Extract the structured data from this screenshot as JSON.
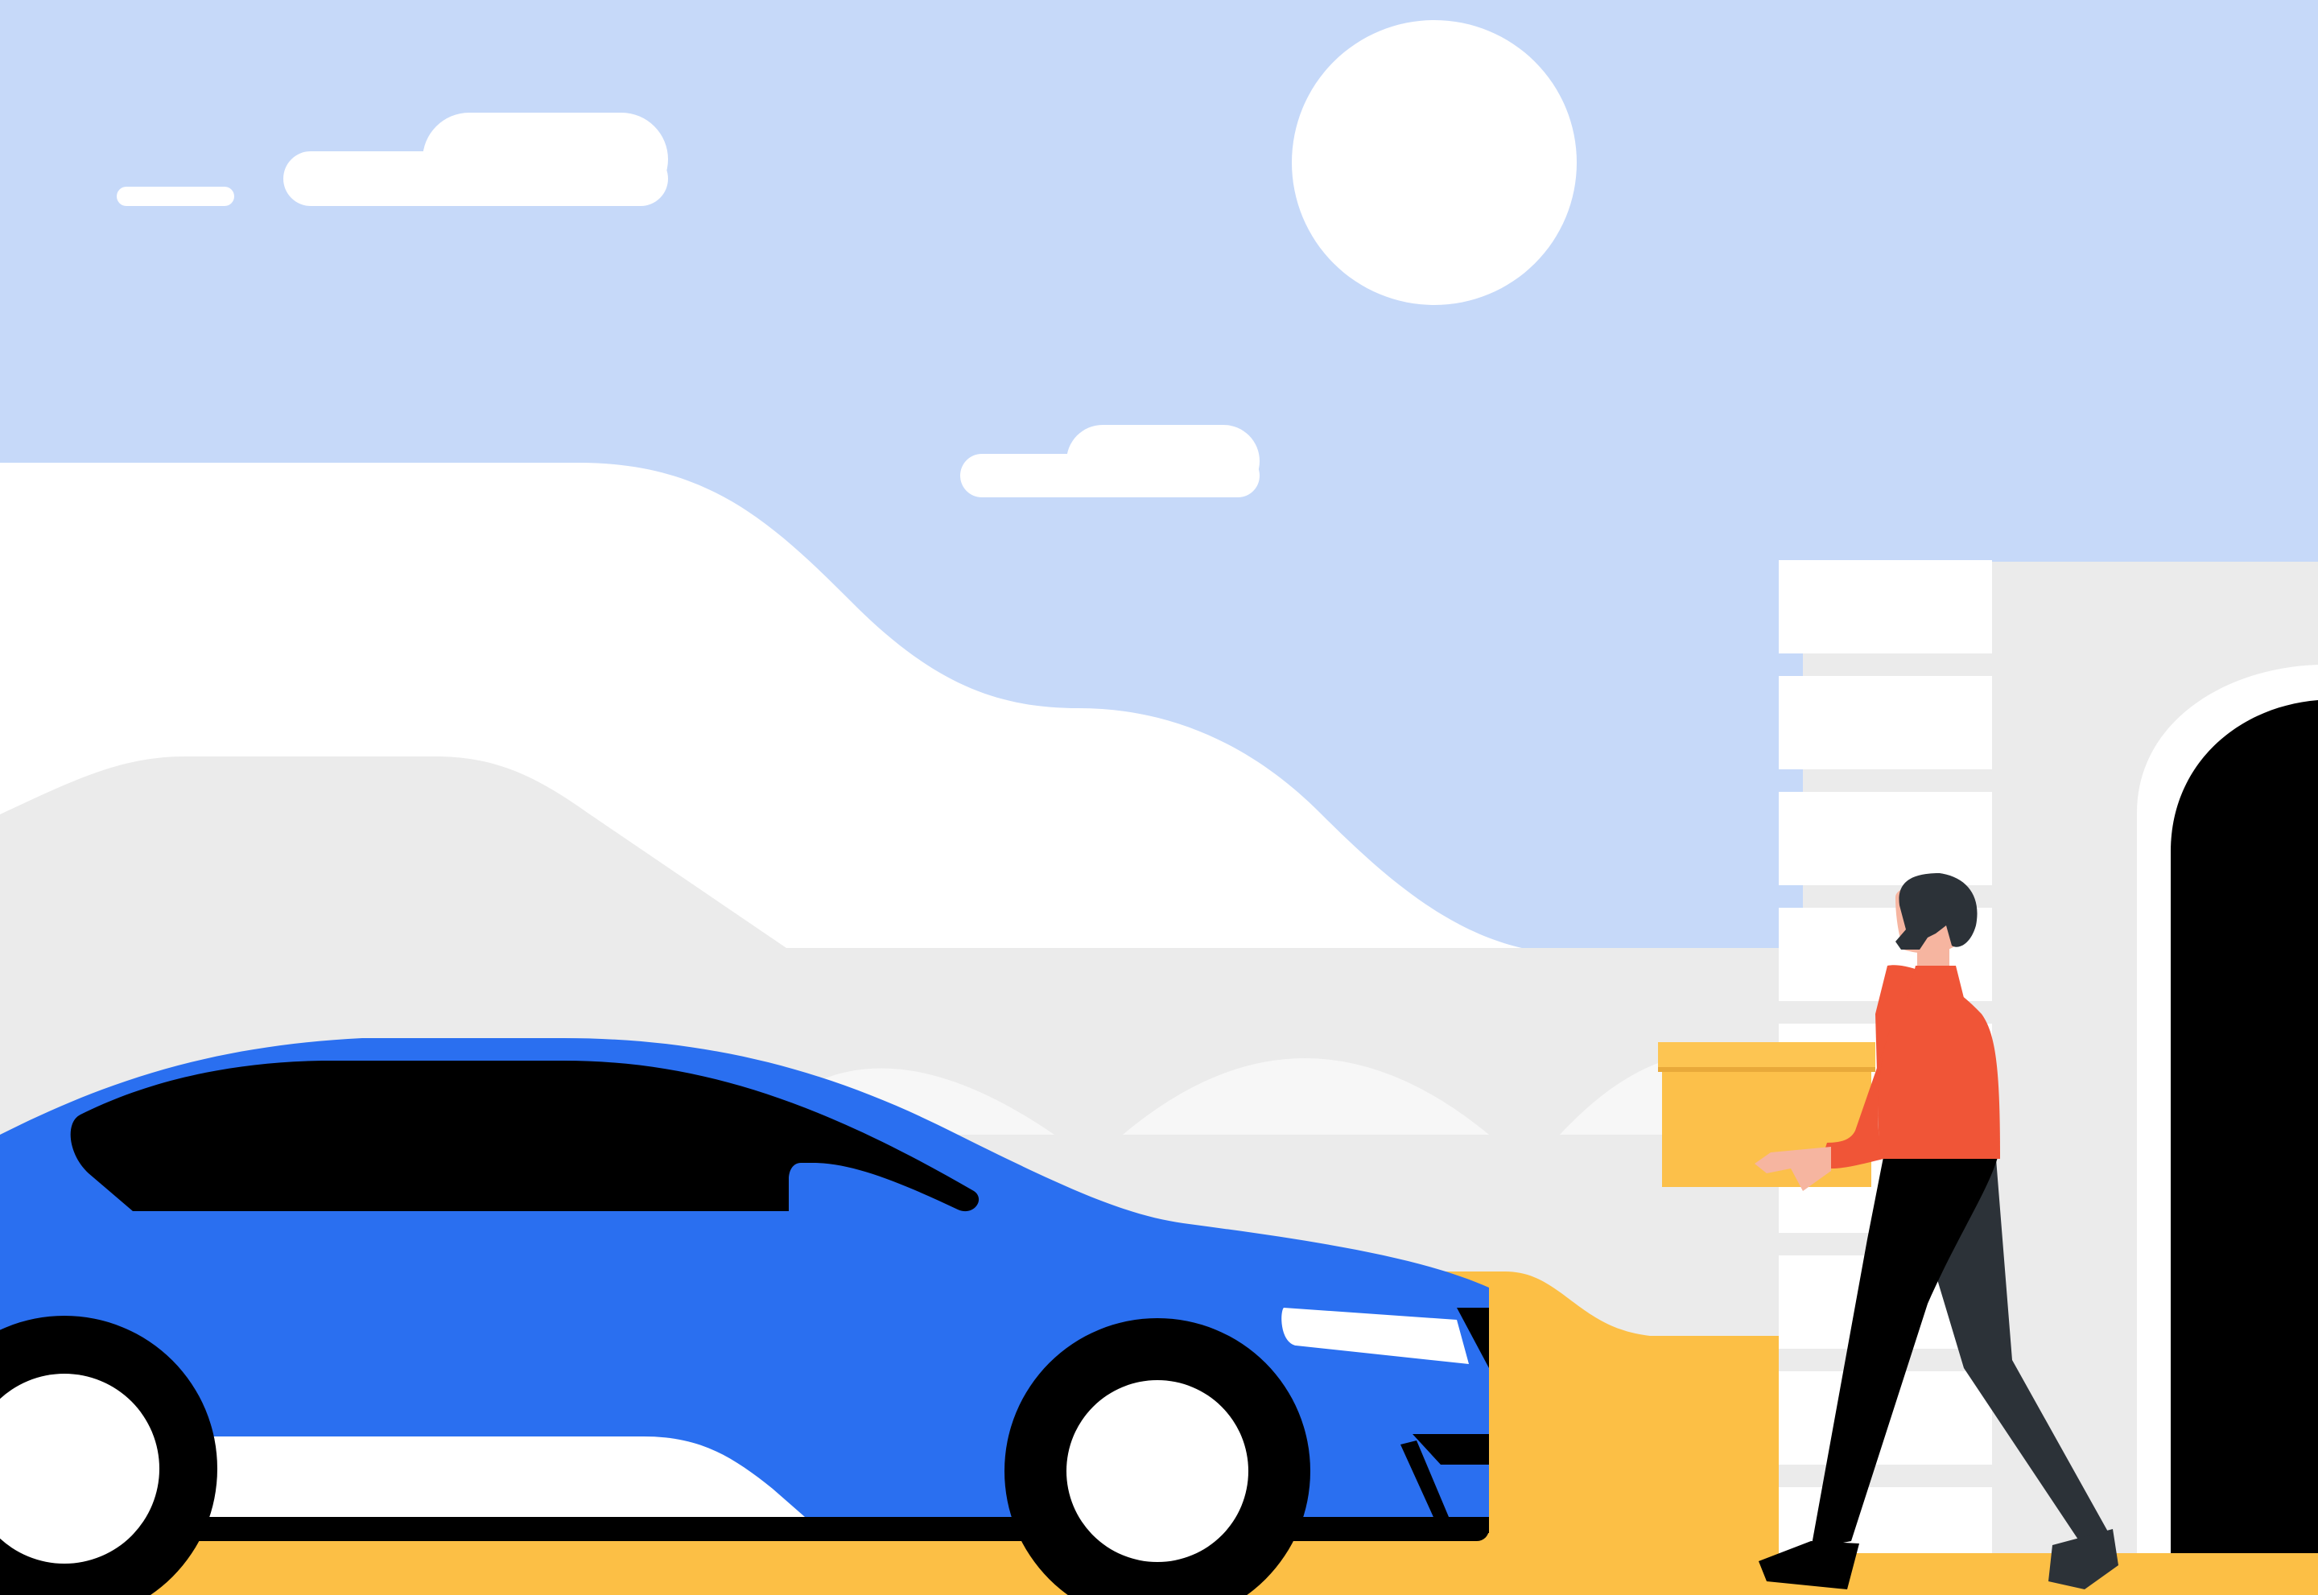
{
  "scene": {
    "description_tag": "illustration",
    "elements": {
      "sky": "sky-background",
      "sun": "sun-icon",
      "clouds": [
        "cloud-small-left",
        "cloud-large-left",
        "cloud-middle"
      ],
      "hills": "white-hills",
      "city": "gray-ground-with-arches",
      "building": "white-tower-building",
      "doorway": "arched-doorway",
      "car": "blue-car",
      "person": "courier-person",
      "box": "cardboard-box",
      "road": "yellow-road"
    },
    "colors": {
      "sky": "#c6d9f9",
      "white": "#ffffff",
      "light_gray": "#ebebeb",
      "arch_gray": "#f7f7f7",
      "car_blue": "#2a6ff0",
      "black": "#000000",
      "road_yellow": "#fcbf45",
      "box_yellow": "#fcc04a",
      "shirt_red": "#f05537",
      "pants_dark": "#2c3238",
      "skin": "#f6b5a0"
    }
  }
}
